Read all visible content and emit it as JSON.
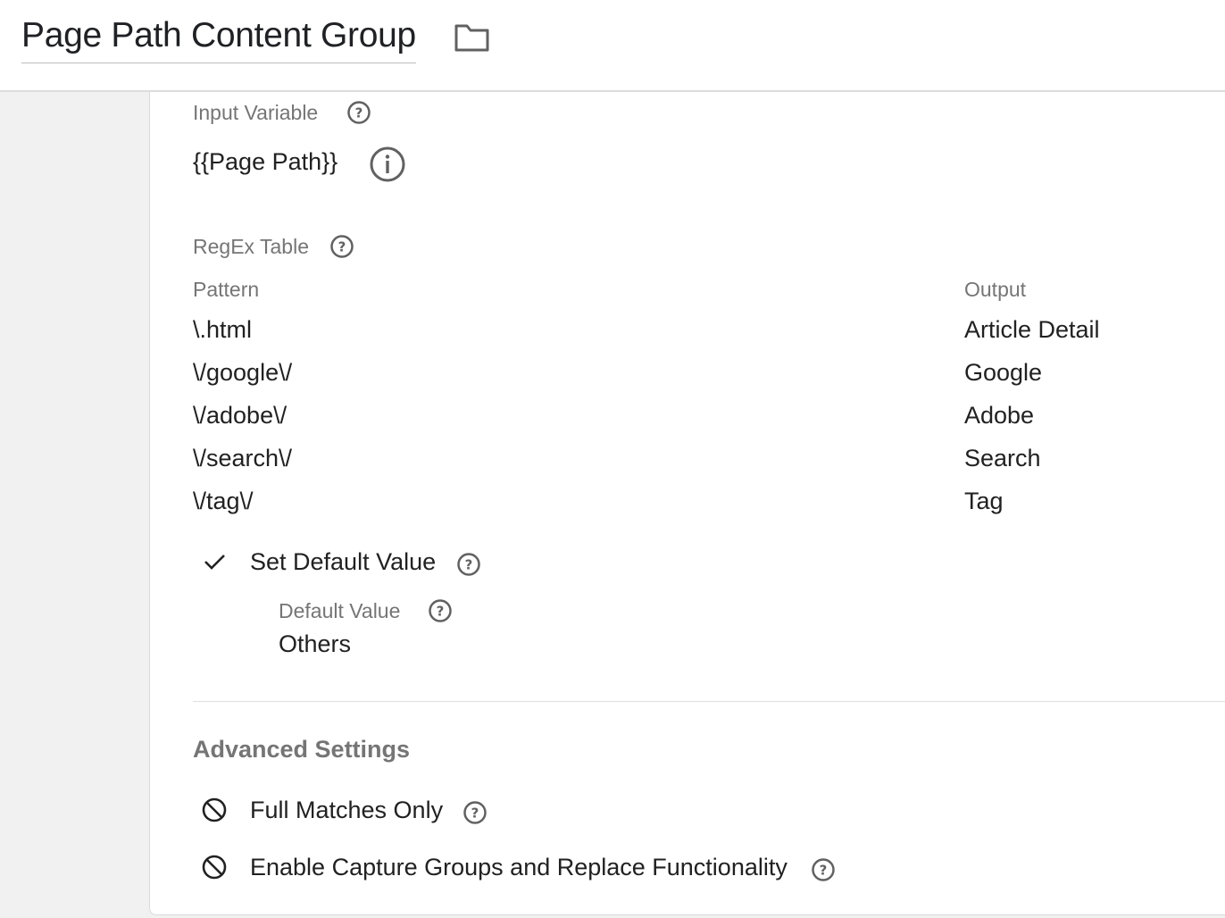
{
  "header": {
    "title": "Page Path Content Group",
    "folder_icon": "folder-icon"
  },
  "input_variable": {
    "label": "Input Variable",
    "value": "{{Page Path}}",
    "info_icon": "info-icon"
  },
  "regex_table": {
    "label": "RegEx Table",
    "columns": {
      "pattern": "Pattern",
      "output": "Output"
    },
    "rows": [
      {
        "pattern": "\\.html",
        "output": "Article Detail"
      },
      {
        "pattern": "\\/google\\/",
        "output": "Google"
      },
      {
        "pattern": "\\/adobe\\/",
        "output": "Adobe"
      },
      {
        "pattern": "\\/search\\/",
        "output": "Search"
      },
      {
        "pattern": "\\/tag\\/",
        "output": "Tag"
      }
    ]
  },
  "default_value": {
    "checkbox_label": "Set Default Value",
    "checked": true,
    "label": "Default Value",
    "value": "Others"
  },
  "advanced_settings": {
    "heading": "Advanced Settings",
    "options": [
      {
        "label": "Full Matches Only",
        "enabled": false,
        "icon": "block-icon"
      },
      {
        "label": "Enable Capture Groups and Replace Functionality",
        "enabled": false,
        "icon": "block-icon"
      }
    ]
  },
  "colors": {
    "label_gray": "#757575",
    "text_dark": "#212121",
    "icon_gray": "#616161",
    "background": "#f1f1f1",
    "card": "#ffffff"
  }
}
